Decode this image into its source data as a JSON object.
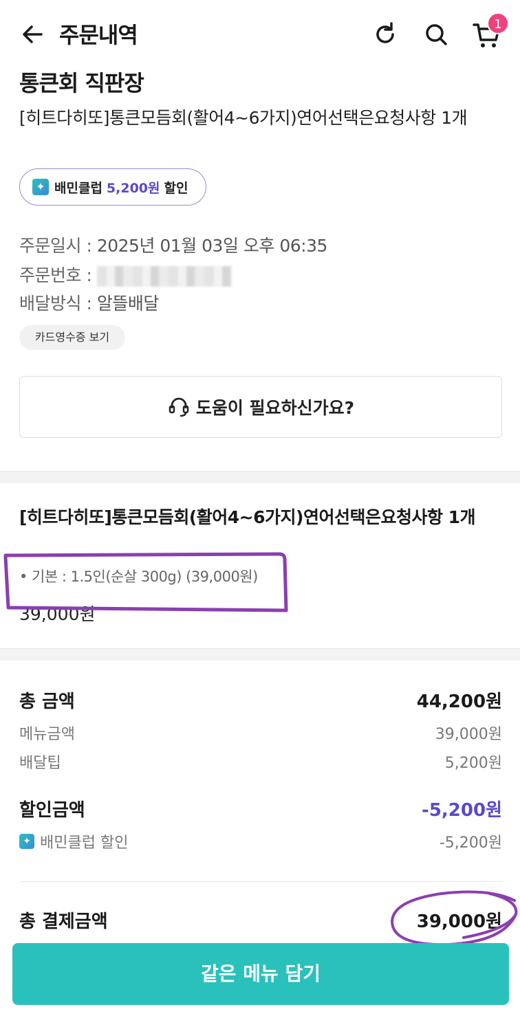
{
  "header": {
    "title": "주문내역",
    "cart_count": "1"
  },
  "store": {
    "name": "통큰회 직판장",
    "order_summary": "[히트다히또]통큰모듬회(활어4~6가지)연어선택은요청사항 1개"
  },
  "club_chip": {
    "brand": "배민클럽",
    "amount": "5,200원",
    "suffix": "할인"
  },
  "order_meta": {
    "date_label": "주문일시 : ",
    "date_value": "2025년 01월 03일 오후 06:35",
    "number_label": "주문번호 : ",
    "delivery_label": "배달방식 : ",
    "delivery_value": "알뜰배달"
  },
  "receipt_button": "카드영수증 보기",
  "help_button": "도움이 필요하신가요?",
  "menu": {
    "title": "[히트다히또]통큰모듬회(활어4~6가지)연어선택은요청사항 1개",
    "option": "• 기본 : 1.5인(순살 300g) (39,000원)",
    "price": "39,000원"
  },
  "totals": {
    "total_label": "총 금액",
    "total_value": "44,200원",
    "menu_label": "메뉴금액",
    "menu_value": "39,000원",
    "tip_label": "배달팁",
    "tip_value": "5,200원",
    "discount_label": "할인금액",
    "discount_value": "-5,200원",
    "club_discount_label": "배민클럽 할인",
    "club_discount_value": "-5,200원",
    "pay_label": "총 결제금액",
    "pay_value": "39,000원"
  },
  "cta_button": "같은 메뉴 담기",
  "colors": {
    "accent": "#2ac1bc",
    "club_purple": "#5a49c9",
    "badge_pink": "#f0417f",
    "annotation": "#8a3fb0"
  }
}
